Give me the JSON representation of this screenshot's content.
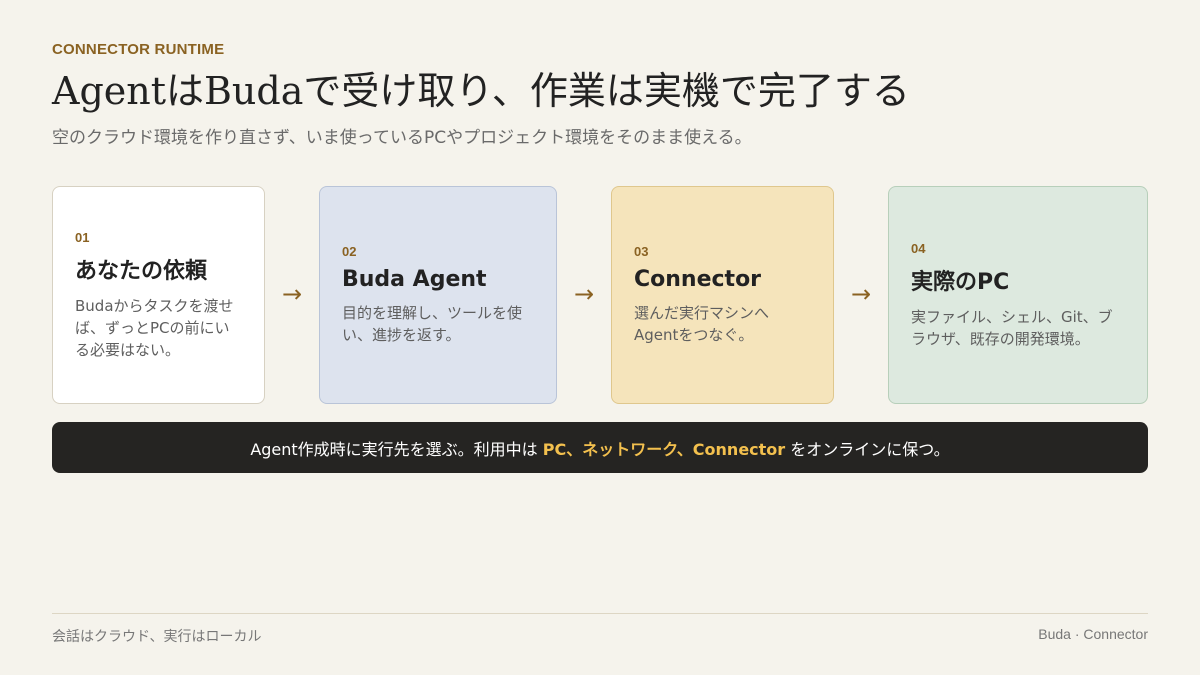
{
  "header": {
    "eyebrow": "CONNECTOR RUNTIME",
    "title": "AgentはBudaで受け取り、作業は実機で完了する",
    "subtitle": "空のクラウド環境を作り直さず、いま使っているPCやプロジェクト環境をそのまま使える。"
  },
  "steps": [
    {
      "num": "01",
      "title": "あなたの依頼",
      "body": "Budaからタスクを渡せば、ずっとPCの前にいる必要はない。"
    },
    {
      "num": "02",
      "title": "Buda Agent",
      "body": "目的を理解し、ツールを使い、進捗を返す。"
    },
    {
      "num": "03",
      "title": "Connector",
      "body": "選んだ実行マシンへAgentをつなぐ。"
    },
    {
      "num": "04",
      "title": "実際のPC",
      "body": "実ファイル、シェル、Git、ブラウザ、既存の開発環境。"
    }
  ],
  "arrow_glyph": "→",
  "banner": {
    "prefix": "Agent作成時に実行先を選ぶ。利用中は",
    "highlight": "PC、ネットワーク、Connector",
    "suffix": "をオンラインに保つ。"
  },
  "footer": {
    "left": "会話はクラウド、実行はローカル",
    "right": "Buda · Connector"
  },
  "colors": {
    "accent": "#8a6222",
    "highlight": "#f3c04e",
    "background": "#f5f3ec",
    "card2": "#dde3ee",
    "card3": "#f5e4bb",
    "card4": "#dde9df"
  }
}
